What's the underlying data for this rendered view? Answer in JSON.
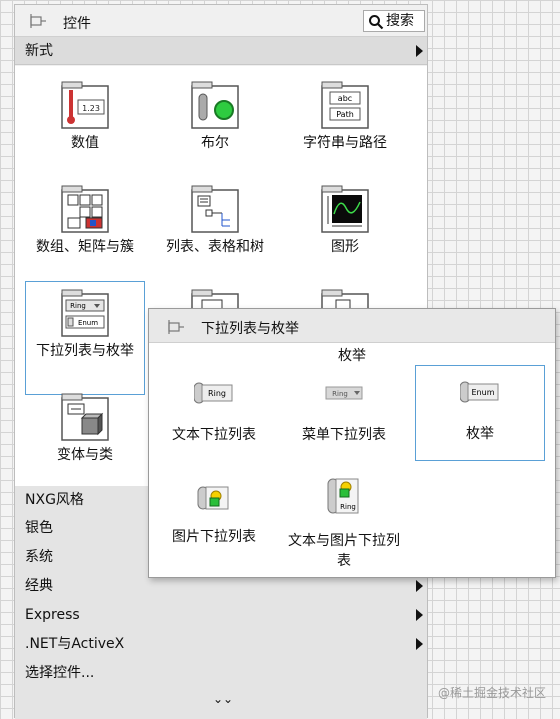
{
  "palette": {
    "title": "控件",
    "search_label": "搜索",
    "category": "新式",
    "items": [
      {
        "label": "数值"
      },
      {
        "label": "布尔"
      },
      {
        "label": "字符串与路径"
      },
      {
        "label": "数组、矩阵与簇"
      },
      {
        "label": "列表、表格和树"
      },
      {
        "label": "图形"
      },
      {
        "label": "下拉列表与枚举"
      },
      {
        "label": "变体与类"
      }
    ],
    "numeric_icon_text": "1.23",
    "string_icon_top": "abc",
    "string_icon_bottom": "Path",
    "ring_icon_text": "Ring",
    "enum_icon_text": "Enum",
    "lists": [
      {
        "label": "NXG风格"
      },
      {
        "label": "银色"
      },
      {
        "label": "系统"
      },
      {
        "label": "经典"
      },
      {
        "label": "Express"
      },
      {
        "label": ".NET与ActiveX"
      },
      {
        "label": "选择控件..."
      }
    ],
    "more_glyph": "⌄⌄"
  },
  "popup": {
    "title": "下拉列表与枚举",
    "subtitle": "枚举",
    "items": [
      {
        "label": "文本下拉列表",
        "icon_text": "Ring"
      },
      {
        "label": "菜单下拉列表",
        "icon_text": "Ring"
      },
      {
        "label": "枚举",
        "icon_text": "Enum"
      },
      {
        "label": "图片下拉列表"
      },
      {
        "label": "文本与图片下拉列表",
        "icon_text": "Ring"
      }
    ]
  },
  "watermark": "@稀土掘金技术社区",
  "colors": {
    "selection": "#5aa0d6",
    "header": "#dcdcdc"
  }
}
